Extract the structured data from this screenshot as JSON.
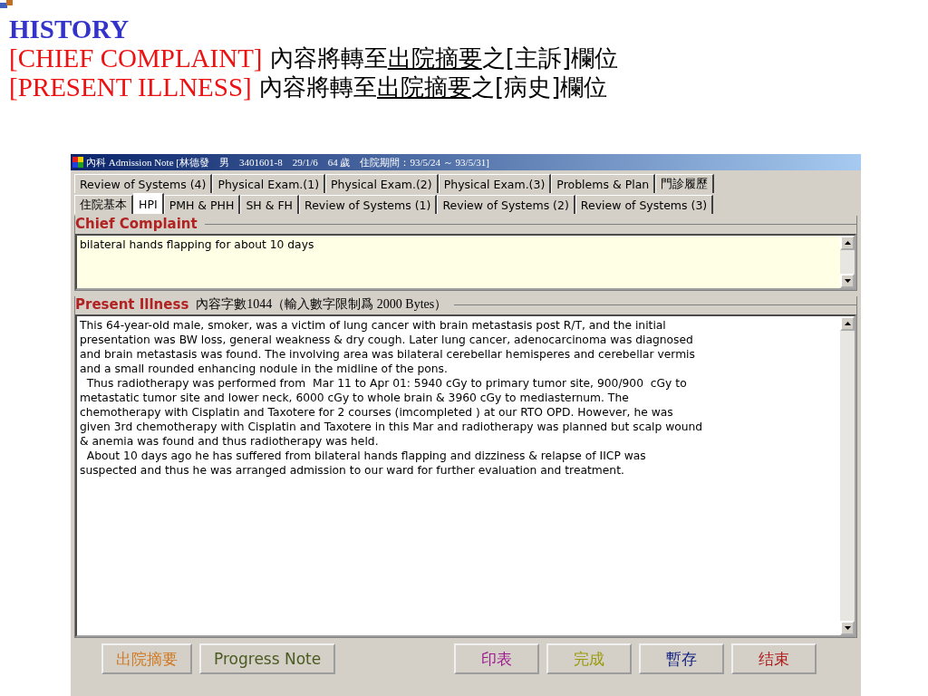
{
  "slide": {
    "heading": "HISTORY",
    "lines": [
      [
        {
          "kind": "red",
          "text": "[CHIEF COMPLAINT]"
        },
        {
          "kind": "plain",
          "text": " 內容將轉至"
        },
        {
          "kind": "underline",
          "text": "出院摘要"
        },
        {
          "kind": "plain",
          "text": "之[主訴]欄位"
        }
      ],
      [
        {
          "kind": "red",
          "text": "[PRESENT ILLNESS]"
        },
        {
          "kind": "plain",
          "text": " 內容將轉至"
        },
        {
          "kind": "underline",
          "text": "出院摘要"
        },
        {
          "kind": "plain",
          "text": "之[病史]欄位"
        }
      ]
    ]
  },
  "window": {
    "title": "內科 Admission Note [林德發　男　3401601-8　29/1/6　64 歲　住院期間：93/5/24 ～ 93/5/31]"
  },
  "tabs_row_1": [
    {
      "label": "Review of Systems (4)",
      "selected": false
    },
    {
      "label": "Physical Exam.(1)",
      "selected": false
    },
    {
      "label": "Physical Exam.(2)",
      "selected": false
    },
    {
      "label": "Physical Exam.(3)",
      "selected": false
    },
    {
      "label": "Problems & Plan",
      "selected": false
    },
    {
      "label": "門診履歷",
      "selected": false
    }
  ],
  "tabs_row_2": [
    {
      "label": "住院基本",
      "selected": false
    },
    {
      "label": "HPI",
      "selected": true
    },
    {
      "label": "PMH & PHH",
      "selected": false
    },
    {
      "label": "SH & FH",
      "selected": false
    },
    {
      "label": "Review of Systems (1)",
      "selected": false
    },
    {
      "label": "Review of Systems (2)",
      "selected": false
    },
    {
      "label": "Review of Systems (3)",
      "selected": false
    }
  ],
  "chief_complaint": {
    "title": "Chief Complaint",
    "value": "bilateral hands flapping for about 10 days"
  },
  "present_illness": {
    "title": "Present Illness",
    "count_note": "內容字數1044（輸入數字限制爲 2000 Bytes）",
    "lines": [
      "This 64-year-old male, smoker, was a victim of lung cancer with brain metastasis post R/T, and the initial",
      "presentation was BW loss, general weakness & dry cough. Later lung cancer, adenocarcinoma was diagnosed",
      "and brain metastasis was found. The involving area was bilateral cerebellar hemisperes and cerebellar vermis",
      "and a small rounded enhancing nodule in the midline of the pons.",
      "  Thus radiotherapy was performed from  Mar 11 to Apr 01: 5940 cGy to primary tumor site, 900/900  cGy to",
      "metastatic tumor site and lower neck, 6000 cGy to whole brain & 3960 cGy to mediasternum. The",
      "chemotherapy with Cisplatin and Taxotere for 2 courses (imcompleted ) at our RTO OPD. However, he was",
      "given 3rd chemotherapy with Cisplatin and Taxotere in this Mar and radiotherapy was planned but scalp wound",
      "& anemia was found and thus radiotherapy was held.",
      "  About 10 days ago he has suffered from bilateral hands flapping and dizziness & relapse of IICP was",
      "suspected and thus he was arranged admission to our ward for further evaluation and treatment."
    ]
  },
  "buttons_left": [
    {
      "label": "出院摘要",
      "color": "#d07820"
    },
    {
      "label": "Progress Note",
      "color": "#4a5a20"
    }
  ],
  "buttons_right": [
    {
      "label": "印表",
      "color": "#a01890"
    },
    {
      "label": "完成",
      "color": "#9a9a10"
    },
    {
      "label": "暫存",
      "color": "#102080"
    },
    {
      "label": "结束",
      "color": "#b02020"
    }
  ]
}
